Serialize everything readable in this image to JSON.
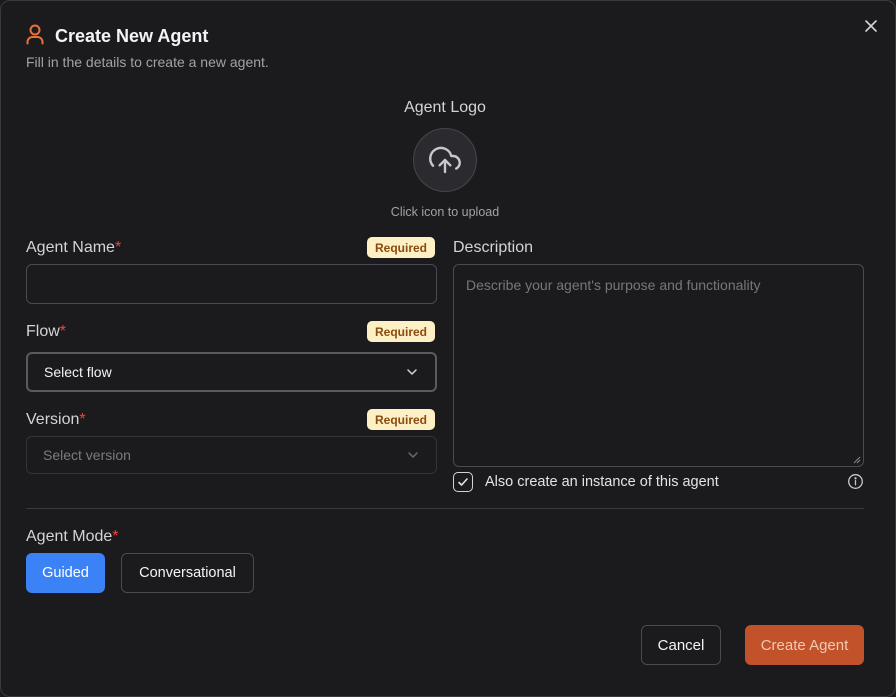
{
  "dialog": {
    "title": "Create New Agent",
    "subtitle": "Fill in the details to create a new agent.",
    "close_icon": "close-icon"
  },
  "logo": {
    "label": "Agent Logo",
    "hint": "Click icon to upload",
    "icon": "cloud-upload-icon"
  },
  "fields": {
    "name": {
      "label": "Agent Name",
      "required_badge": "Required",
      "value": ""
    },
    "flow": {
      "label": "Flow",
      "required_badge": "Required",
      "value": "Select flow"
    },
    "version": {
      "label": "Version",
      "required_badge": "Required",
      "placeholder": "Select version"
    },
    "description": {
      "label": "Description",
      "placeholder": "Describe your agent's purpose and functionality"
    },
    "required_mark": "*"
  },
  "instance_option": {
    "label": "Also create an instance of this agent",
    "checked": true
  },
  "mode": {
    "label": "Agent Mode",
    "options": [
      "Guided",
      "Conversational"
    ],
    "selected": "Guided"
  },
  "actions": {
    "cancel": "Cancel",
    "create": "Create Agent"
  },
  "colors": {
    "accent": "#e8703a",
    "primary_blue": "#3b82f6",
    "create_button": "#c2522a",
    "badge_bg": "#fdf0c4",
    "required_star": "#ef4444"
  }
}
